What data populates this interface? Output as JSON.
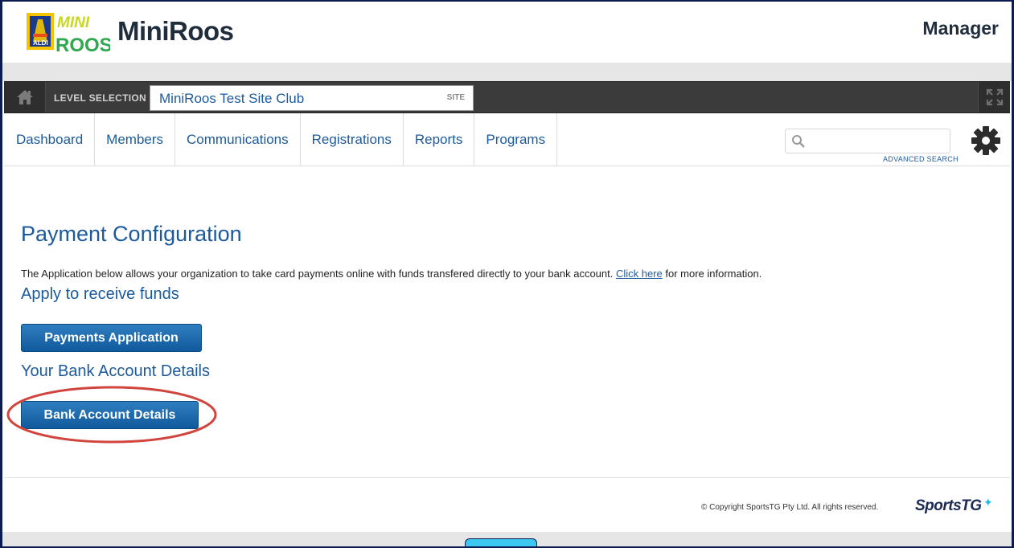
{
  "header": {
    "logo_text_top": "MINI",
    "logo_text_bottom": "ROOS",
    "logo_badge": "ALDI",
    "brand": "MiniRoos",
    "role": "Manager"
  },
  "level_bar": {
    "label": "LEVEL SELECTION",
    "value": "MiniRoos Test Site Club",
    "type": "SITE"
  },
  "nav": {
    "items": [
      {
        "label": "Dashboard"
      },
      {
        "label": "Members"
      },
      {
        "label": "Communications"
      },
      {
        "label": "Registrations"
      },
      {
        "label": "Reports"
      },
      {
        "label": "Programs"
      }
    ],
    "search_value": "",
    "advanced_search": "ADVANCED SEARCH"
  },
  "main": {
    "title": "Payment Configuration",
    "description_before": "The Application below allows your organization to take card payments online with funds transfered directly to your bank account. ",
    "description_link": "Click here",
    "description_after": " for more information.",
    "section_apply": "Apply to receive funds",
    "payments_button": "Payments Application",
    "section_bank": "Your Bank Account Details",
    "bank_button": "Bank Account Details"
  },
  "footer": {
    "copyright": "©  Copyright SportsTG Pty Ltd. All rights reserved.",
    "logo": "SportsTG"
  },
  "colors": {
    "accent": "#1c5a9c",
    "highlight": "#d0453e",
    "dark_bar": "#3b3b3b"
  }
}
